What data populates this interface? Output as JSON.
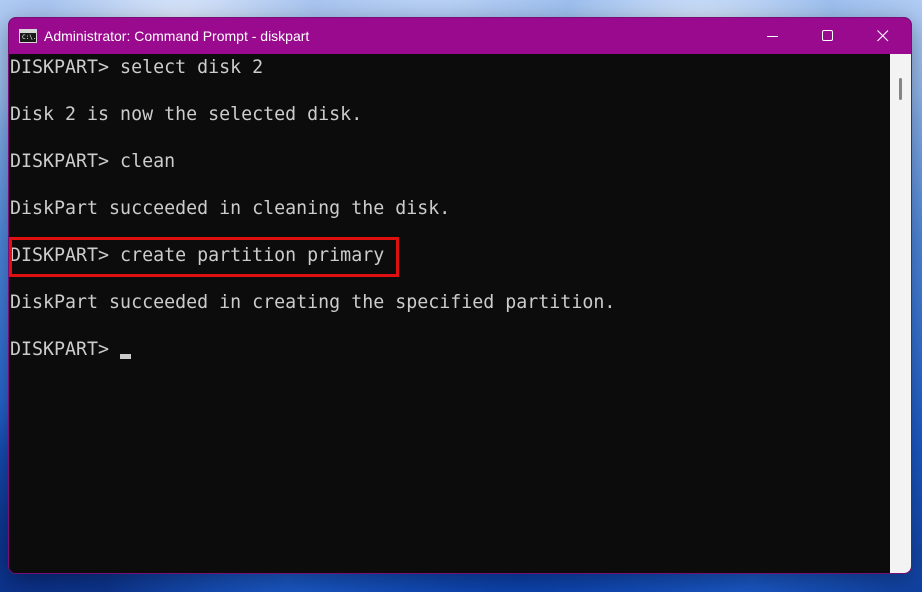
{
  "window": {
    "title": "Administrator: Command Prompt - diskpart",
    "icon": "command-prompt-icon",
    "icon_text": "C:\\.",
    "titlebar_color": "#9a0a8f",
    "controls": {
      "minimize": "minimize-icon",
      "maximize": "maximize-icon",
      "close": "close-icon"
    }
  },
  "console": {
    "lines": [
      "DISKPART> select disk 2",
      "Disk 2 is now the selected disk.",
      "DISKPART> clean",
      "DiskPart succeeded in cleaning the disk.",
      "DISKPART> create partition primary",
      "DiskPart succeeded in creating the specified partition.",
      "DISKPART> "
    ],
    "highlighted_line": "DISKPART> create partition primary",
    "highlight_color": "#e01010",
    "text_color": "#cccccc",
    "background_color": "#0c0c0c"
  }
}
